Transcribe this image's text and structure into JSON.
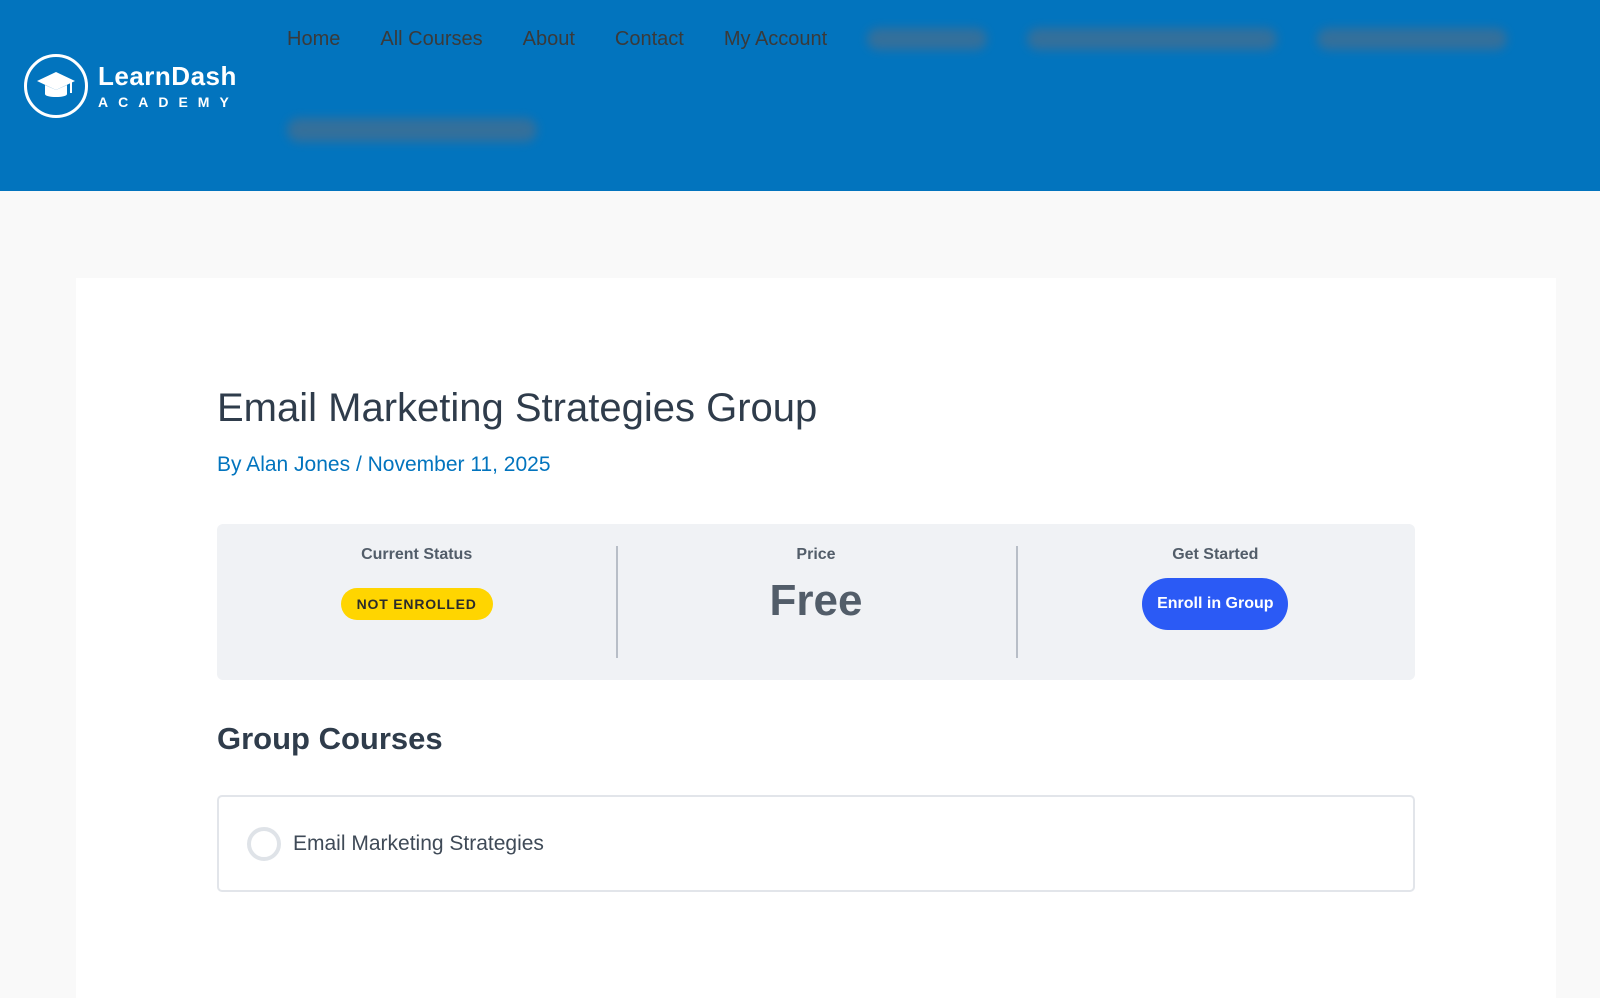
{
  "brand": {
    "name": "LearnDash",
    "sub": "ACADEMY"
  },
  "nav": {
    "items": [
      {
        "label": "Home"
      },
      {
        "label": "All Courses"
      },
      {
        "label": "About"
      },
      {
        "label": "Contact"
      },
      {
        "label": "My Account"
      }
    ]
  },
  "colors": {
    "header_bg": "#0274be",
    "link": "#0274be",
    "badge": "#ffd500",
    "button": "#2b5af5"
  },
  "page": {
    "title": "Email Marketing Strategies Group",
    "author": "By Alan Jones",
    "separator": "/",
    "date": "November 11, 2025"
  },
  "infobar": {
    "status_label": "Current Status",
    "status_value": "NOT ENROLLED",
    "price_label": "Price",
    "price_value": "Free",
    "start_label": "Get Started",
    "enroll_button": "Enroll in Group"
  },
  "group_courses": {
    "heading": "Group Courses",
    "items": [
      {
        "name": "Email Marketing Strategies",
        "icon": "empty-circle-icon"
      }
    ]
  }
}
